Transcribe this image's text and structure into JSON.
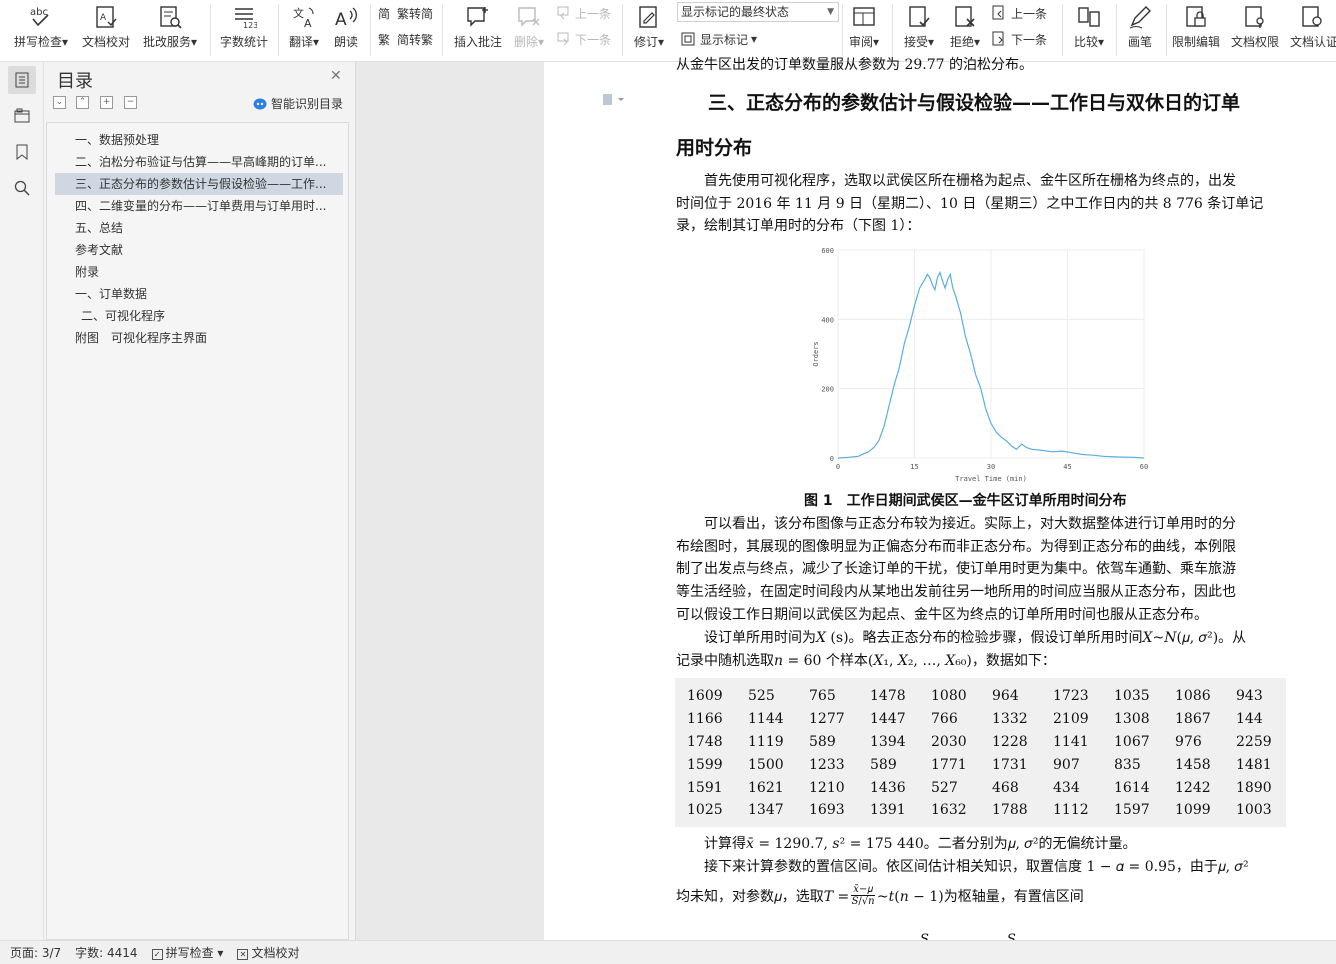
{
  "toolbar": {
    "spell_check": "拼写检查",
    "doc_check": "文档校对",
    "batch_service": "批改服务",
    "word_count": "字数统计",
    "translate": "翻译",
    "read_aloud": "朗读",
    "trad_to_simp": "繁转简",
    "simp_to_trad": "简转繁",
    "insert_comment": "插入批注",
    "delete": "删除",
    "prev_comment": "上一条",
    "next_comment": "下一条",
    "revise": "修订",
    "markup_state": "显示标记的最终状态",
    "show_markup": "显示标记",
    "review": "审阅",
    "accept": "接受",
    "reject": "拒绝",
    "prev_change": "上一条",
    "next_change": "下一条",
    "compare": "比较",
    "pen": "画笔",
    "restrict_edit": "限制编辑",
    "doc_permission": "文档权限",
    "doc_cert": "文档认证"
  },
  "toc": {
    "title": "目录",
    "smart_label": "智能识别目录",
    "items": [
      "一、数据预处理",
      "二、泊松分布验证与估算——早高峰期的订单...",
      "三、正态分布的参数估计与假设检验——工作...",
      "四、二维变量的分布——订单费用与订单用时...",
      "五、总结",
      "参考文献",
      "附录",
      "一、订单数据",
      "二、可视化程序",
      "附图　可视化程序主界面"
    ]
  },
  "doc": {
    "top_line": "从金牛区出发的订单数量服从参数为 29.77 的泊松分布。",
    "heading_l1": "三、正态分布的参数估计与假设检验——工作日与双休日的订单",
    "heading_l2": "用时分布",
    "para1_l1": "首先使用可视化程序，选取以武侯区所在栅格为起点、金牛区所在栅格为终点的，出发",
    "para1_l2": "时间位于 2016 年 11 月 9 日（星期二）、10 日（星期三）之中工作日内的共 8 776 条订单记",
    "para1_l3": "录，绘制其订单用时的分布（下图 1）：",
    "fig_caption": "图 1　工作日期间武侯区—金牛区订单所用时间分布",
    "para2_l1": "可以看出，该分布图像与正态分布较为接近。实际上，对大数据整体进行订单用时的分",
    "para2_l2": "布绘图时，其展现的图像明显为正偏态分布而非正态分布。为得到正态分布的曲线，本例限",
    "para2_l3": "制了出发点与终点，减少了长途订单的干扰，使订单用时更为集中。依驾车通勤、乘车旅游",
    "para2_l4": "等生活经验，在固定时间段内从某地出发前往另一地所用的时间应当服从正态分布，因此也",
    "para2_l5": "可以假设工作日期间以武侯区为起点、金牛区为终点的订单所用时间也服从正态分布。",
    "para3_l1": "设订单所用时间为𝑋 (s)。略去正态分布的检验步骤，假设订单所用时间𝑋~𝑁(𝜇, 𝜎²)。从",
    "para3_l2": "记录中随机选取𝑛 = 60 个样本(𝑋₁, 𝑋₂, …, 𝑋₆₀)，数据如下：",
    "para4": "计算得𝑥̄ = 1290.7, 𝑠² = 175 440。二者分别为𝜇, 𝜎²的无偏统计量。",
    "para5_l1": "接下来计算参数的置信区间。依区间估计相关知识，取置信度 1 − 𝛼 = 0.95，由于𝜇, 𝜎²",
    "para5_l2a": "均未知，对参数𝜇，选取𝑇 =",
    "frac_num": "𝑥̄−𝜇",
    "frac_den": "𝑆/√𝑛",
    "para5_l2b": "~𝑡(𝑛 − 1)为枢轴量，有置信区间",
    "bottom_partial": "𝑆　　　　　　𝑆",
    "data_rows": [
      [
        "1609",
        "525",
        "765",
        "1478",
        "1080",
        "964",
        "1723",
        "1035",
        "1086",
        "943"
      ],
      [
        "1166",
        "1144",
        "1277",
        "1447",
        "766",
        "1332",
        "2109",
        "1308",
        "1867",
        "144"
      ],
      [
        "1748",
        "1119",
        "589",
        "1394",
        "2030",
        "1228",
        "1141",
        "1067",
        "976",
        "2259"
      ],
      [
        "1599",
        "1500",
        "1233",
        "589",
        "1771",
        "1731",
        "907",
        "835",
        "1458",
        "1481"
      ],
      [
        "1591",
        "1621",
        "1210",
        "1436",
        "527",
        "468",
        "434",
        "1614",
        "1242",
        "1890"
      ],
      [
        "1025",
        "1347",
        "1693",
        "1391",
        "1632",
        "1788",
        "1112",
        "1597",
        "1099",
        "1003"
      ]
    ]
  },
  "chart_data": {
    "type": "line",
    "title": "",
    "xlabel": "Travel Time (min)",
    "ylabel": "Orders",
    "xlim": [
      0,
      60
    ],
    "ylim": [
      0,
      600
    ],
    "x_ticks": [
      0,
      15,
      30,
      45,
      60
    ],
    "y_ticks": [
      0,
      200,
      400,
      600
    ],
    "grid": true,
    "color": "#5aaee0",
    "x": [
      0,
      2,
      4,
      5,
      6,
      7,
      8,
      9,
      10,
      11,
      12,
      13,
      14,
      15,
      16,
      17,
      17.5,
      18,
      18.5,
      19,
      19.5,
      20,
      20.5,
      21,
      21.5,
      22,
      22.5,
      23,
      24,
      25,
      26,
      27,
      28,
      29,
      30,
      31,
      32,
      33,
      34,
      35,
      36,
      37,
      38,
      40,
      42,
      44,
      46,
      48,
      50,
      52,
      55,
      58,
      60
    ],
    "y": [
      0,
      2,
      5,
      12,
      18,
      30,
      50,
      90,
      150,
      210,
      260,
      330,
      380,
      440,
      490,
      515,
      530,
      520,
      500,
      485,
      520,
      535,
      510,
      490,
      515,
      530,
      490,
      470,
      420,
      350,
      300,
      240,
      200,
      140,
      100,
      75,
      60,
      50,
      35,
      25,
      40,
      30,
      25,
      22,
      18,
      20,
      15,
      10,
      8,
      5,
      3,
      2,
      0
    ]
  },
  "status": {
    "page": "页面: 3/7",
    "words": "字数: 4414",
    "spell": "拼写检查",
    "doc_check": "文档校对"
  }
}
